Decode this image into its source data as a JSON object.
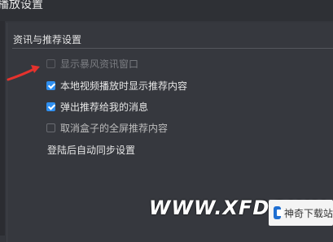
{
  "window": {
    "title": "播放设置"
  },
  "section": {
    "title": "资讯与推荐设置"
  },
  "options": [
    {
      "label": "显示暴风资讯窗口",
      "checked": false,
      "enabled": false
    },
    {
      "label": "本地视频播放时显示推荐内容",
      "checked": true,
      "enabled": true
    },
    {
      "label": "弹出推荐给我的消息",
      "checked": true,
      "enabled": true
    },
    {
      "label": "取消盒子的全屏推荐内容",
      "checked": false,
      "enabled": true
    }
  ],
  "sync": {
    "label": "登陆后自动同步设置"
  },
  "watermark": {
    "text": "WWW.XFDOWN",
    "badge": "神奇下载站"
  },
  "colors": {
    "accent": "#2f8ff0",
    "annotation_arrow": "#e5322d",
    "background": "#36383e"
  }
}
